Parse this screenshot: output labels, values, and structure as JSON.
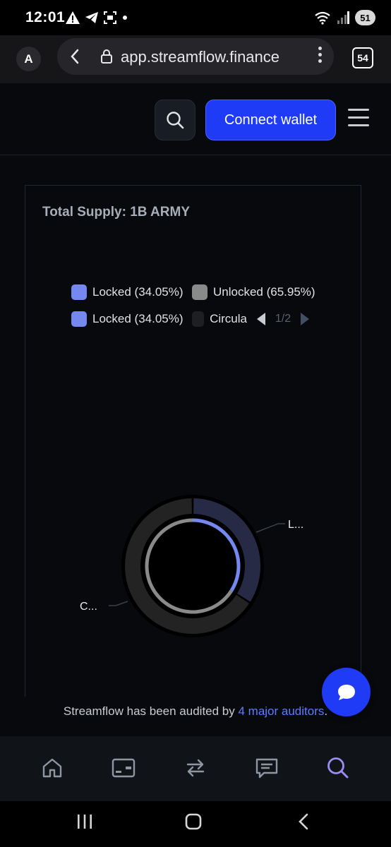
{
  "status_bar": {
    "time": "12:01",
    "battery": "51"
  },
  "browser": {
    "profile_initial": "A",
    "url": "app.streamflow.finance",
    "tab_count": "54"
  },
  "header": {
    "connect_wallet_label": "Connect wallet"
  },
  "card": {
    "title": "Total Supply: 1B ARMY",
    "legend": {
      "row1": [
        {
          "label": "Locked (34.05%)",
          "color": "#7488f0"
        },
        {
          "label": "Unlocked (65.95%)",
          "color": "#8a8a8a"
        }
      ],
      "row2": [
        {
          "label": "Locked (34.05%)",
          "color": "#7488f0"
        },
        {
          "label": "Circula",
          "color": "#1e1f22"
        }
      ],
      "pager": "1/2"
    },
    "slice_labels": {
      "outer_locked": "L...",
      "outer_circulating": "C..."
    }
  },
  "chart_data": {
    "type": "pie",
    "title": "Total Supply: 1B ARMY",
    "rings": [
      {
        "ring": "outer",
        "slices": [
          {
            "name": "Locked",
            "label": "L...",
            "value": 34.05,
            "color": "#262a44"
          },
          {
            "name": "Circula",
            "label": "C...",
            "value": 65.95,
            "color": "#232323"
          }
        ]
      },
      {
        "ring": "inner",
        "slices": [
          {
            "name": "Locked",
            "value": 34.05,
            "color": "#7488f0"
          },
          {
            "name": "Unlocked",
            "value": 65.95,
            "color": "#8a8a8a"
          }
        ]
      }
    ],
    "legend_position": "top"
  },
  "footer": {
    "audit_text": "Streamflow has been audited by ",
    "audit_link": "4 major auditors",
    "audit_end": "."
  },
  "icons": {
    "nav": [
      "home-icon",
      "wallet-icon",
      "swap-icon",
      "chat-list-icon",
      "search-icon"
    ],
    "active_nav_color": "#9d8cf5"
  }
}
